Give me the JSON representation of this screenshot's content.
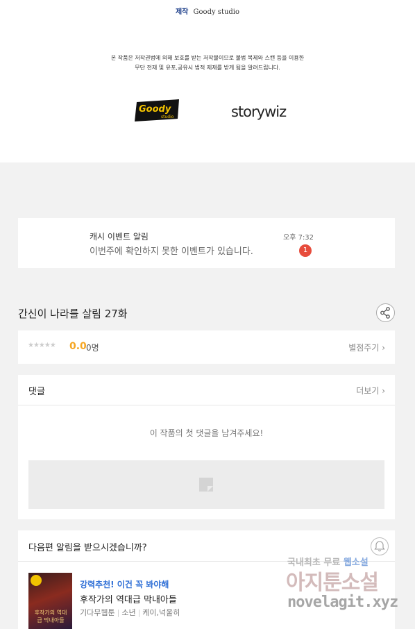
{
  "credits": {
    "label": "제작",
    "studio": "Goody studio",
    "copyright_line1": "본 작품은 저작권법에 의해 보호를 받는 저작물이므로 불법 복제와 스캔 등을 이용한",
    "copyright_line2": "무단 전재 및 유포,공유시 법적 제재를 받게 됨을 알려드립니다.",
    "logo_goody_line1": "Goody",
    "logo_goody_line2": "studio",
    "logo_storywiz": "storywiz"
  },
  "notification": {
    "title": "캐시 이벤트 알림",
    "message": "이번주에 확인하지 못한 이벤트가 있습니다.",
    "time": "오후 7:32",
    "badge": "1"
  },
  "episode": {
    "title": "간신이 나라를 살림 27화"
  },
  "rating": {
    "stars": "★★★★★",
    "score": "0.0",
    "count": "0명",
    "rate_label": "별점주기 ›"
  },
  "comments": {
    "title": "댓글",
    "more_label": "더보기 ›",
    "empty_text": "이 작품의 첫 댓글을 남겨주세요!"
  },
  "subscribe": {
    "question": "다음편 알림을 받으시겠습니까?"
  },
  "recommendation": {
    "tag": "강력추천! 이건 꼭 봐야해",
    "title": "후작가의 역대급 막내아들",
    "category": "기다무웹툰",
    "genre": "소년",
    "authors": "케이,넉울히",
    "cover_text": "후작가의 역대급 막내아들"
  },
  "watermark": {
    "top_left": "국내최초 무료",
    "top_highlight": "웹소설",
    "main": "아지툰소설",
    "url": "novelagit.xyz"
  }
}
